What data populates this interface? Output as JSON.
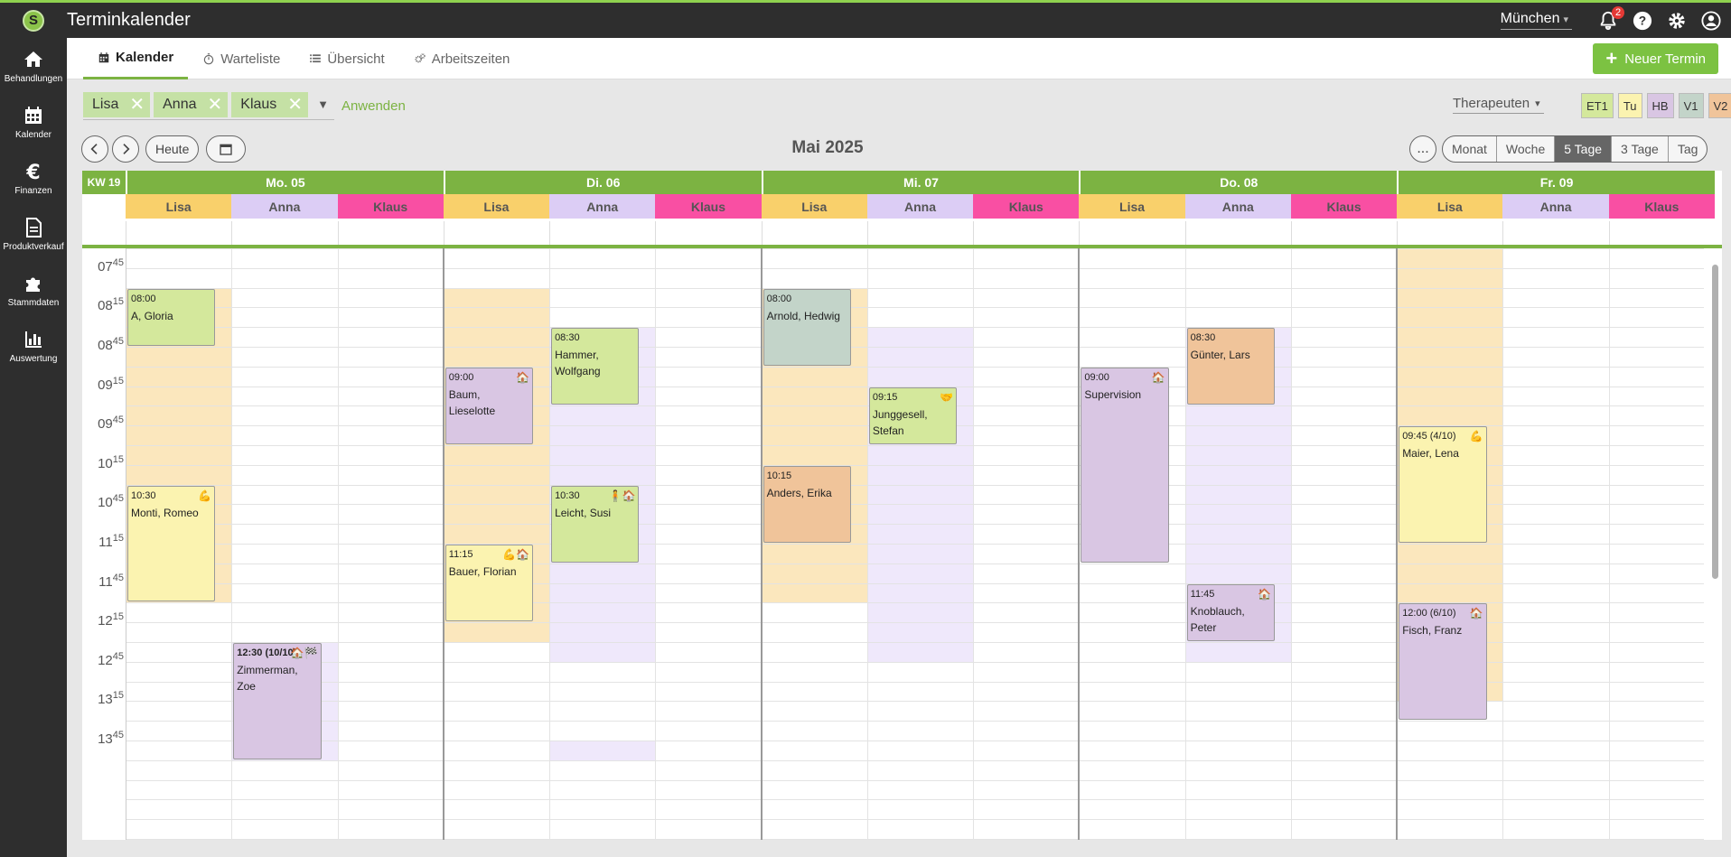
{
  "app": {
    "title": "Terminkalender",
    "location": "München",
    "notifications": "2",
    "logo_letter": "S"
  },
  "sidebar": {
    "items": [
      {
        "label": "Behandlungen",
        "icon": "home-icon"
      },
      {
        "label": "Kalender",
        "icon": "calendar-icon"
      },
      {
        "label": "Finanzen",
        "icon": "euro-icon"
      },
      {
        "label": "Produktverkauf",
        "icon": "document-icon"
      },
      {
        "label": "Stammdaten",
        "icon": "puzzle-icon"
      },
      {
        "label": "Auswertung",
        "icon": "bar-chart-icon"
      }
    ]
  },
  "tabs": [
    {
      "label": "Kalender",
      "active": true
    },
    {
      "label": "Warteliste"
    },
    {
      "label": "Übersicht"
    },
    {
      "label": "Arbeitszeiten"
    }
  ],
  "new_button": "Neuer Termin",
  "filter": {
    "chips": [
      "Lisa",
      "Anna",
      "Klaus"
    ],
    "apply": "Anwenden",
    "therapist_select": "Therapeuten"
  },
  "legend": [
    {
      "code": "ET1",
      "color": "#d4e89c"
    },
    {
      "code": "Tu",
      "color": "#fbf3b0"
    },
    {
      "code": "HB",
      "color": "#d9c6e3"
    },
    {
      "code": "V1",
      "color": "#c3d4c9"
    },
    {
      "code": "V2",
      "color": "#f0c49a"
    }
  ],
  "toolbar": {
    "today": "Heute",
    "month_title": "Mai 2025",
    "more": "...",
    "views": [
      "Monat",
      "Woche",
      "5 Tage",
      "3 Tage",
      "Tag"
    ],
    "active_view": "5 Tage"
  },
  "calendar": {
    "week": "KW 19",
    "days": [
      "Mo. 05",
      "Di. 06",
      "Mi. 07",
      "Do. 08",
      "Fr. 09"
    ],
    "therapists": [
      {
        "name": "Lisa",
        "color": "#f9d06b"
      },
      {
        "name": "Anna",
        "color": "#dccdf5"
      },
      {
        "name": "Klaus",
        "color": "#f94fa3"
      }
    ],
    "time_labels": [
      {
        "h": "07",
        "m": "45"
      },
      {
        "h": "08",
        "m": "15"
      },
      {
        "h": "08",
        "m": "45"
      },
      {
        "h": "09",
        "m": "15"
      },
      {
        "h": "09",
        "m": "45"
      },
      {
        "h": "10",
        "m": "15"
      },
      {
        "h": "10",
        "m": "45"
      },
      {
        "h": "11",
        "m": "15"
      },
      {
        "h": "11",
        "m": "45"
      },
      {
        "h": "12",
        "m": "15"
      },
      {
        "h": "12",
        "m": "45"
      },
      {
        "h": "13",
        "m": "15"
      },
      {
        "h": "13",
        "m": "45"
      }
    ],
    "events": [
      {
        "day": 0,
        "col": 0,
        "start": "08:00",
        "end": "08:45",
        "time": "08:00",
        "name": "A, Gloria",
        "type": "ET1",
        "icons": ""
      },
      {
        "day": 0,
        "col": 0,
        "start": "10:30",
        "end": "12:00",
        "time": "10:30",
        "name": "Monti, Romeo",
        "type": "Tu",
        "icons": "💪"
      },
      {
        "day": 0,
        "col": 1,
        "start": "12:30",
        "end": "14:00",
        "time": "12:30 (10/10)",
        "name": "Zimmerman, Zoe",
        "type": "HB",
        "icons": "🏠🏁",
        "bold_time": true
      },
      {
        "day": 1,
        "col": 0,
        "start": "09:00",
        "end": "10:00",
        "time": "09:00",
        "name": "Baum, Lieselotte",
        "type": "HB",
        "icons": "🏠"
      },
      {
        "day": 1,
        "col": 0,
        "start": "11:15",
        "end": "12:15",
        "time": "11:15",
        "name": "Bauer, Florian",
        "type": "Tu",
        "icons": "💪🏠"
      },
      {
        "day": 1,
        "col": 1,
        "start": "08:30",
        "end": "09:30",
        "time": "08:30",
        "name": "Hammer, Wolfgang",
        "type": "ET1",
        "icons": ""
      },
      {
        "day": 1,
        "col": 1,
        "start": "10:30",
        "end": "11:30",
        "time": "10:30",
        "name": "Leicht, Susi",
        "type": "ET1",
        "icons": "🧍🏠"
      },
      {
        "day": 2,
        "col": 0,
        "start": "08:00",
        "end": "09:00",
        "time": "08:00",
        "name": "Arnold, Hedwig",
        "type": "V1",
        "icons": ""
      },
      {
        "day": 2,
        "col": 0,
        "start": "10:15",
        "end": "11:15",
        "time": "10:15",
        "name": "Anders, Erika",
        "type": "V2",
        "icons": ""
      },
      {
        "day": 2,
        "col": 1,
        "start": "09:15",
        "end": "10:00",
        "time": "09:15",
        "name": "Junggesell, Stefan",
        "type": "ET1",
        "icons": "🤝"
      },
      {
        "day": 3,
        "col": 0,
        "start": "09:00",
        "end": "11:30",
        "time": "09:00",
        "name": "Supervision",
        "type": "HB",
        "icons": "🏠"
      },
      {
        "day": 3,
        "col": 1,
        "start": "08:30",
        "end": "09:30",
        "time": "08:30",
        "name": "Günter, Lars",
        "type": "V2",
        "icons": ""
      },
      {
        "day": 3,
        "col": 1,
        "start": "11:45",
        "end": "12:30",
        "time": "11:45",
        "name": "Knoblauch, Peter",
        "type": "HB",
        "icons": "🏠"
      },
      {
        "day": 4,
        "col": 0,
        "start": "09:45",
        "end": "11:15",
        "time": "09:45 (4/10)",
        "name": "Maier, Lena",
        "type": "Tu",
        "icons": "💪"
      },
      {
        "day": 4,
        "col": 0,
        "start": "12:00",
        "end": "13:30",
        "time": "12:00 (6/10)",
        "name": "Fisch, Franz",
        "type": "HB",
        "icons": "🏠"
      }
    ],
    "availability": [
      {
        "day": 0,
        "col": 0,
        "start": "08:00",
        "end": "12:00",
        "color": "#fbe7bd"
      },
      {
        "day": 0,
        "col": 1,
        "start": "12:30",
        "end": "14:00",
        "color": "#efe8fb"
      },
      {
        "day": 1,
        "col": 0,
        "start": "08:00",
        "end": "12:30",
        "color": "#fbe7bd"
      },
      {
        "day": 1,
        "col": 1,
        "start": "08:30",
        "end": "12:45",
        "color": "#efe8fb"
      },
      {
        "day": 1,
        "col": 1,
        "start": "13:45",
        "end": "14:00",
        "color": "#efe8fb"
      },
      {
        "day": 2,
        "col": 0,
        "start": "08:00",
        "end": "12:00",
        "color": "#fbe7bd"
      },
      {
        "day": 2,
        "col": 1,
        "start": "08:30",
        "end": "12:45",
        "color": "#efe8fb"
      },
      {
        "day": 3,
        "col": 1,
        "start": "08:30",
        "end": "12:45",
        "color": "#efe8fb"
      },
      {
        "day": 4,
        "col": 0,
        "start": "07:30",
        "end": "13:15",
        "color": "#fbe7bd"
      }
    ]
  }
}
